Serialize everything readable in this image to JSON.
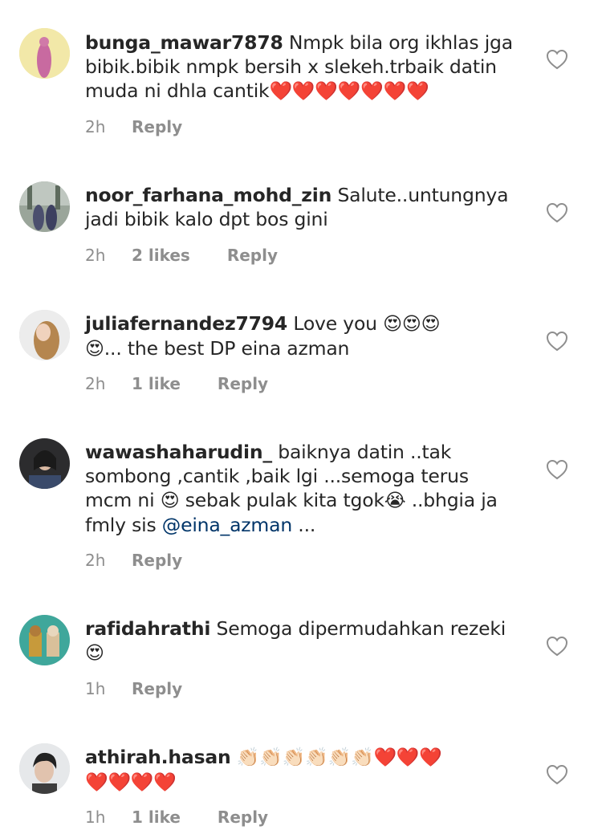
{
  "comments": [
    {
      "username": "bunga_mawar7878",
      "text": "Nmpk bila org ikhlas jga bibik.bibik nmpk bersih x slekeh.trbaik datin muda ni dhla cantik",
      "emojis": "❤️❤️❤️❤️❤️❤️❤️",
      "time": "2h",
      "likes": "",
      "reply": "Reply"
    },
    {
      "username": "noor_farhana_mohd_zin",
      "text": "Salute..untungnya jadi bibik kalo dpt bos gini",
      "time": "2h",
      "likes": "2 likes",
      "reply": "Reply"
    },
    {
      "username": "juliafernandez7794",
      "text_before": "Love you",
      "emojis": "😍😍😍",
      "emoji_line2": "😍",
      "text_after": "... the best DP eina azman",
      "time": "2h",
      "likes": "1 like",
      "reply": "Reply"
    },
    {
      "username": "wawashaharudin_",
      "text_part1": " baiknya datin ..tak sombong ,cantik ,baik lgi ...semoga terus mcm ni",
      "emoji1": "😍",
      "text_part2": " sebak pulak kita tgok",
      "emoji2": "😭",
      "text_part3": " ..bhgia ja fmly sis ",
      "mention": "@eina_azman",
      "text_part4": " ...",
      "time": "2h",
      "likes": "",
      "reply": "Reply"
    },
    {
      "username": "rafidahrathi",
      "text": "Semoga dipermudahkan rezeki",
      "emoji": "😍",
      "time": "1h",
      "likes": "",
      "reply": "Reply"
    },
    {
      "username": "athirah.hasan",
      "emojis_line1": "👏🏻👏🏻👏🏻👏🏻👏🏻👏🏻❤️❤️❤️",
      "emojis_line2": "❤️❤️❤️❤️",
      "time": "1h",
      "likes": "1 like",
      "reply": "Reply"
    }
  ],
  "icons": {
    "like": "heart-outline-icon"
  },
  "colors": {
    "text": "#262626",
    "meta": "#8e8e8e",
    "mention": "#003569"
  }
}
